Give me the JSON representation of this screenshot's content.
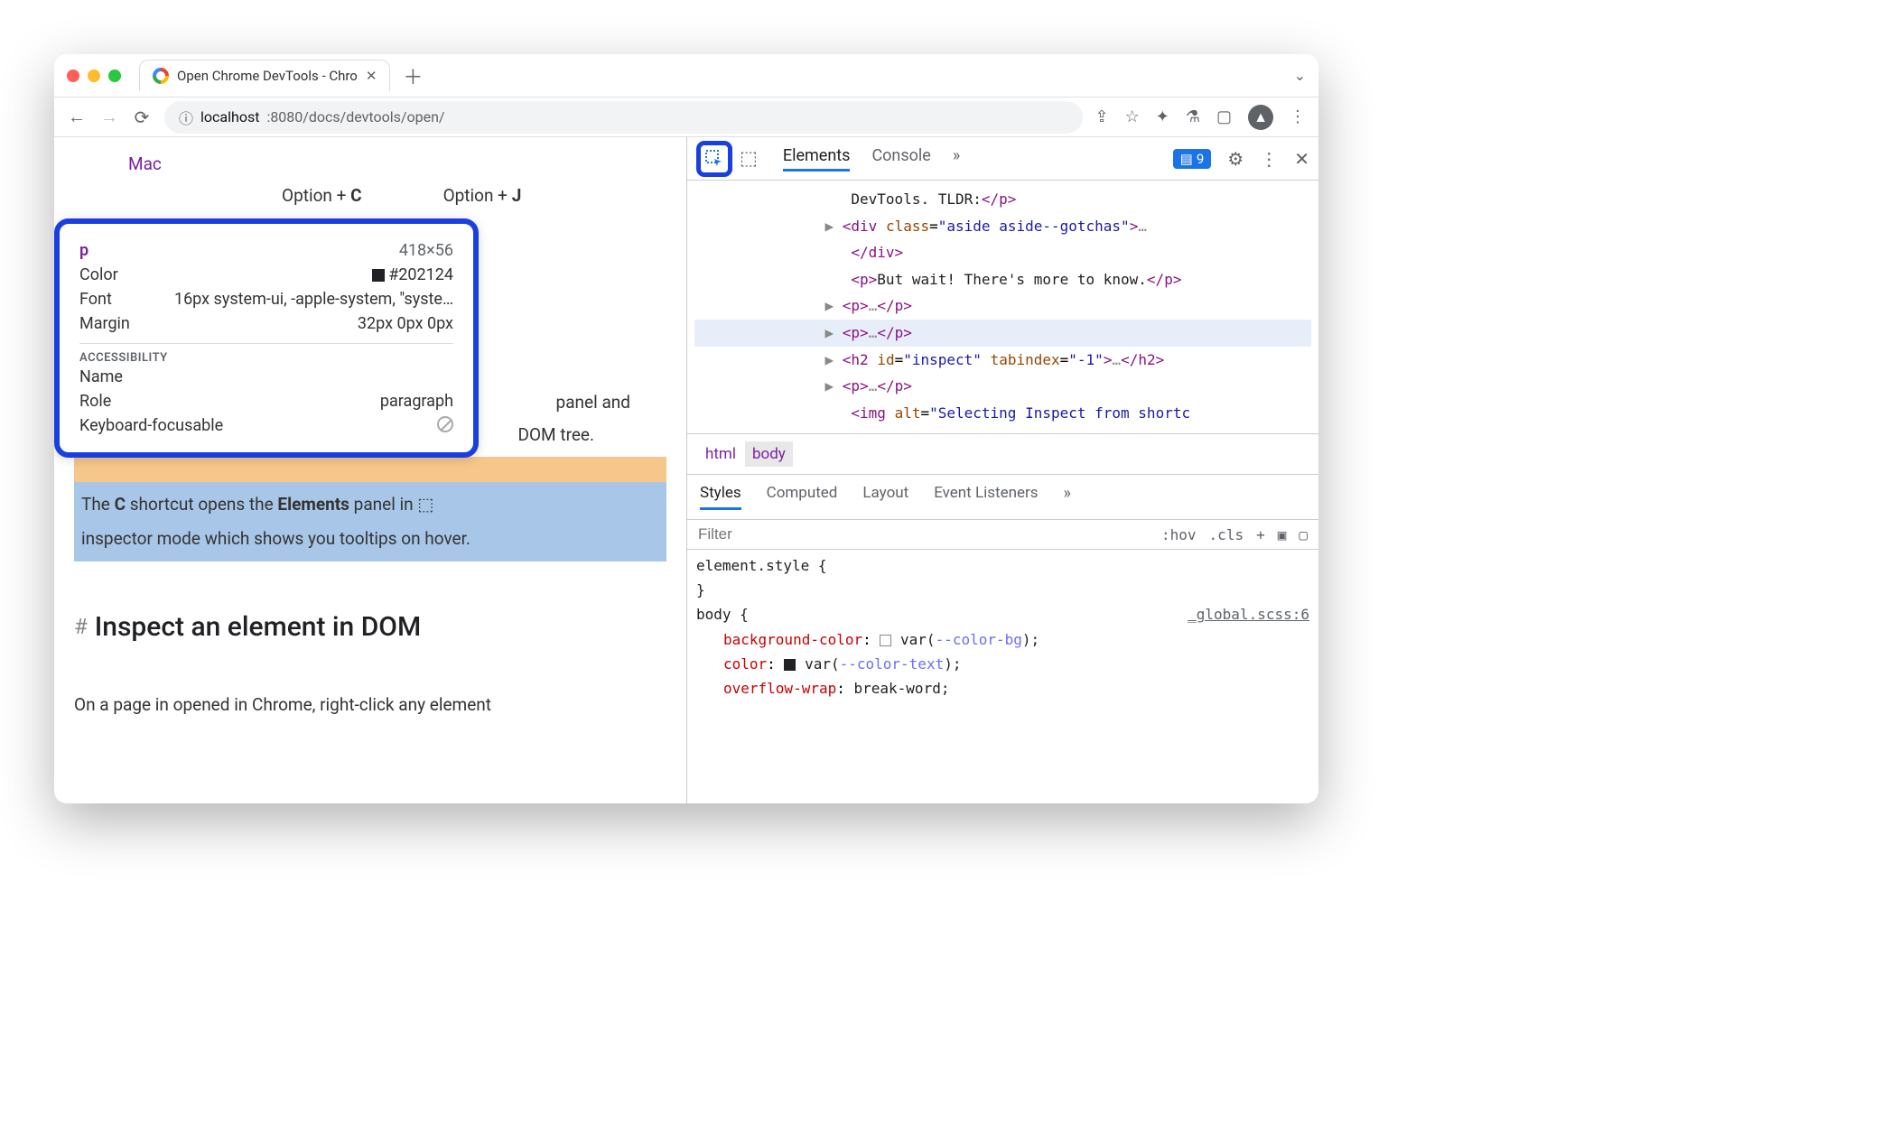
{
  "tab": {
    "title": "Open Chrome DevTools - Chro"
  },
  "url": {
    "host": "localhost",
    "rest": ":8080/docs/devtools/open/"
  },
  "page": {
    "mac": "Mac",
    "opt_c_a": "Option + ",
    "opt_c_b": "C",
    "opt_j_a": "Option + ",
    "opt_j_b": "J",
    "panel_and": " panel and",
    "dom_tree": "DOM tree.",
    "hlt_pre": "The ",
    "hlt_c": "C",
    "hlt_mid": " shortcut opens the ",
    "hlt_el": "Elements",
    "hlt_post": " panel in ",
    "hlt_line2": "inspector mode which shows you tooltips on hover.",
    "h2": "Inspect an element in DOM",
    "follow": "On a page in opened in Chrome, right-click any element"
  },
  "tooltip": {
    "tag": "p",
    "dim": "418×56",
    "color_l": "Color",
    "color_v": "#202124",
    "font_l": "Font",
    "font_v": "16px system-ui, -apple-system, \"syste…",
    "margin_l": "Margin",
    "margin_v": "32px 0px 0px",
    "acc": "ACCESSIBILITY",
    "name_l": "Name",
    "role_l": "Role",
    "role_v": "paragraph",
    "kb_l": "Keyboard-focusable"
  },
  "devtools": {
    "tabs": {
      "elements": "Elements",
      "console": "Console"
    },
    "issues": "9",
    "crumbs": {
      "html": "html",
      "body": "body"
    },
    "styles": {
      "tabs": {
        "styles": "Styles",
        "computed": "Computed",
        "layout": "Layout",
        "evt": "Event Listeners"
      },
      "filter": "Filter",
      "hov": ":hov",
      "cls": ".cls"
    },
    "css": {
      "elstyle": "element.style {",
      "brace": "}",
      "bodysel": "body {",
      "src": "_global.scss:6",
      "p1": "background-color",
      "v1": "var(",
      "var1": "--color-bg",
      "v1b": ");",
      "p2": "color",
      "v2": "var(",
      "var2": "--color-text",
      "v2b": ");",
      "p3": "overflow-wrap",
      "v3": "break-word;"
    },
    "dom": {
      "l1a": "DevTools. TLDR:",
      "l1b": "</p>",
      "l2": "<div class=\"aside aside--gotchas\">",
      "l2e": "…",
      "l2c": "</div>",
      "l3a": "<p>",
      "l3b": "But wait! There's more to know.",
      "l3c": "</p>",
      "l4": "<p>",
      "l4e": "…",
      "l4c": "</p>",
      "l5": "<p>",
      "l5e": "…",
      "l5c": "</p>",
      "l6": "<h2 id=\"inspect\" tabindex=\"-1\">",
      "l6e": "…",
      "l6c": "</h2>",
      "l7": "<p>",
      "l7e": "…",
      "l7c": "</p>",
      "l8": "<img alt=\"Selecting Inspect from shortc"
    }
  }
}
